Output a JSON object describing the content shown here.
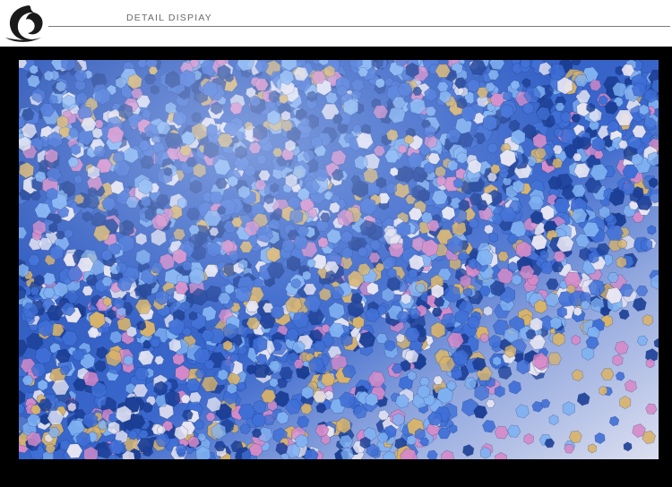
{
  "header": {
    "title": "DETAIL DISPIAY",
    "logo_icon": "brand-logo-swirl-icon"
  },
  "photo": {
    "subject": "glitter-detail-photo",
    "colors": {
      "deep": "#1c3f96",
      "mid": "#3f6fd6",
      "bright": "#7fb1f2",
      "silver": "#e8e6f2",
      "gold": "#d8b36a",
      "pink": "#d68ac8",
      "background": "#d6d9ec"
    }
  },
  "colors": {
    "frame": "#000000",
    "rule": "#7a7a7a",
    "title_text": "#6a6a6a"
  }
}
